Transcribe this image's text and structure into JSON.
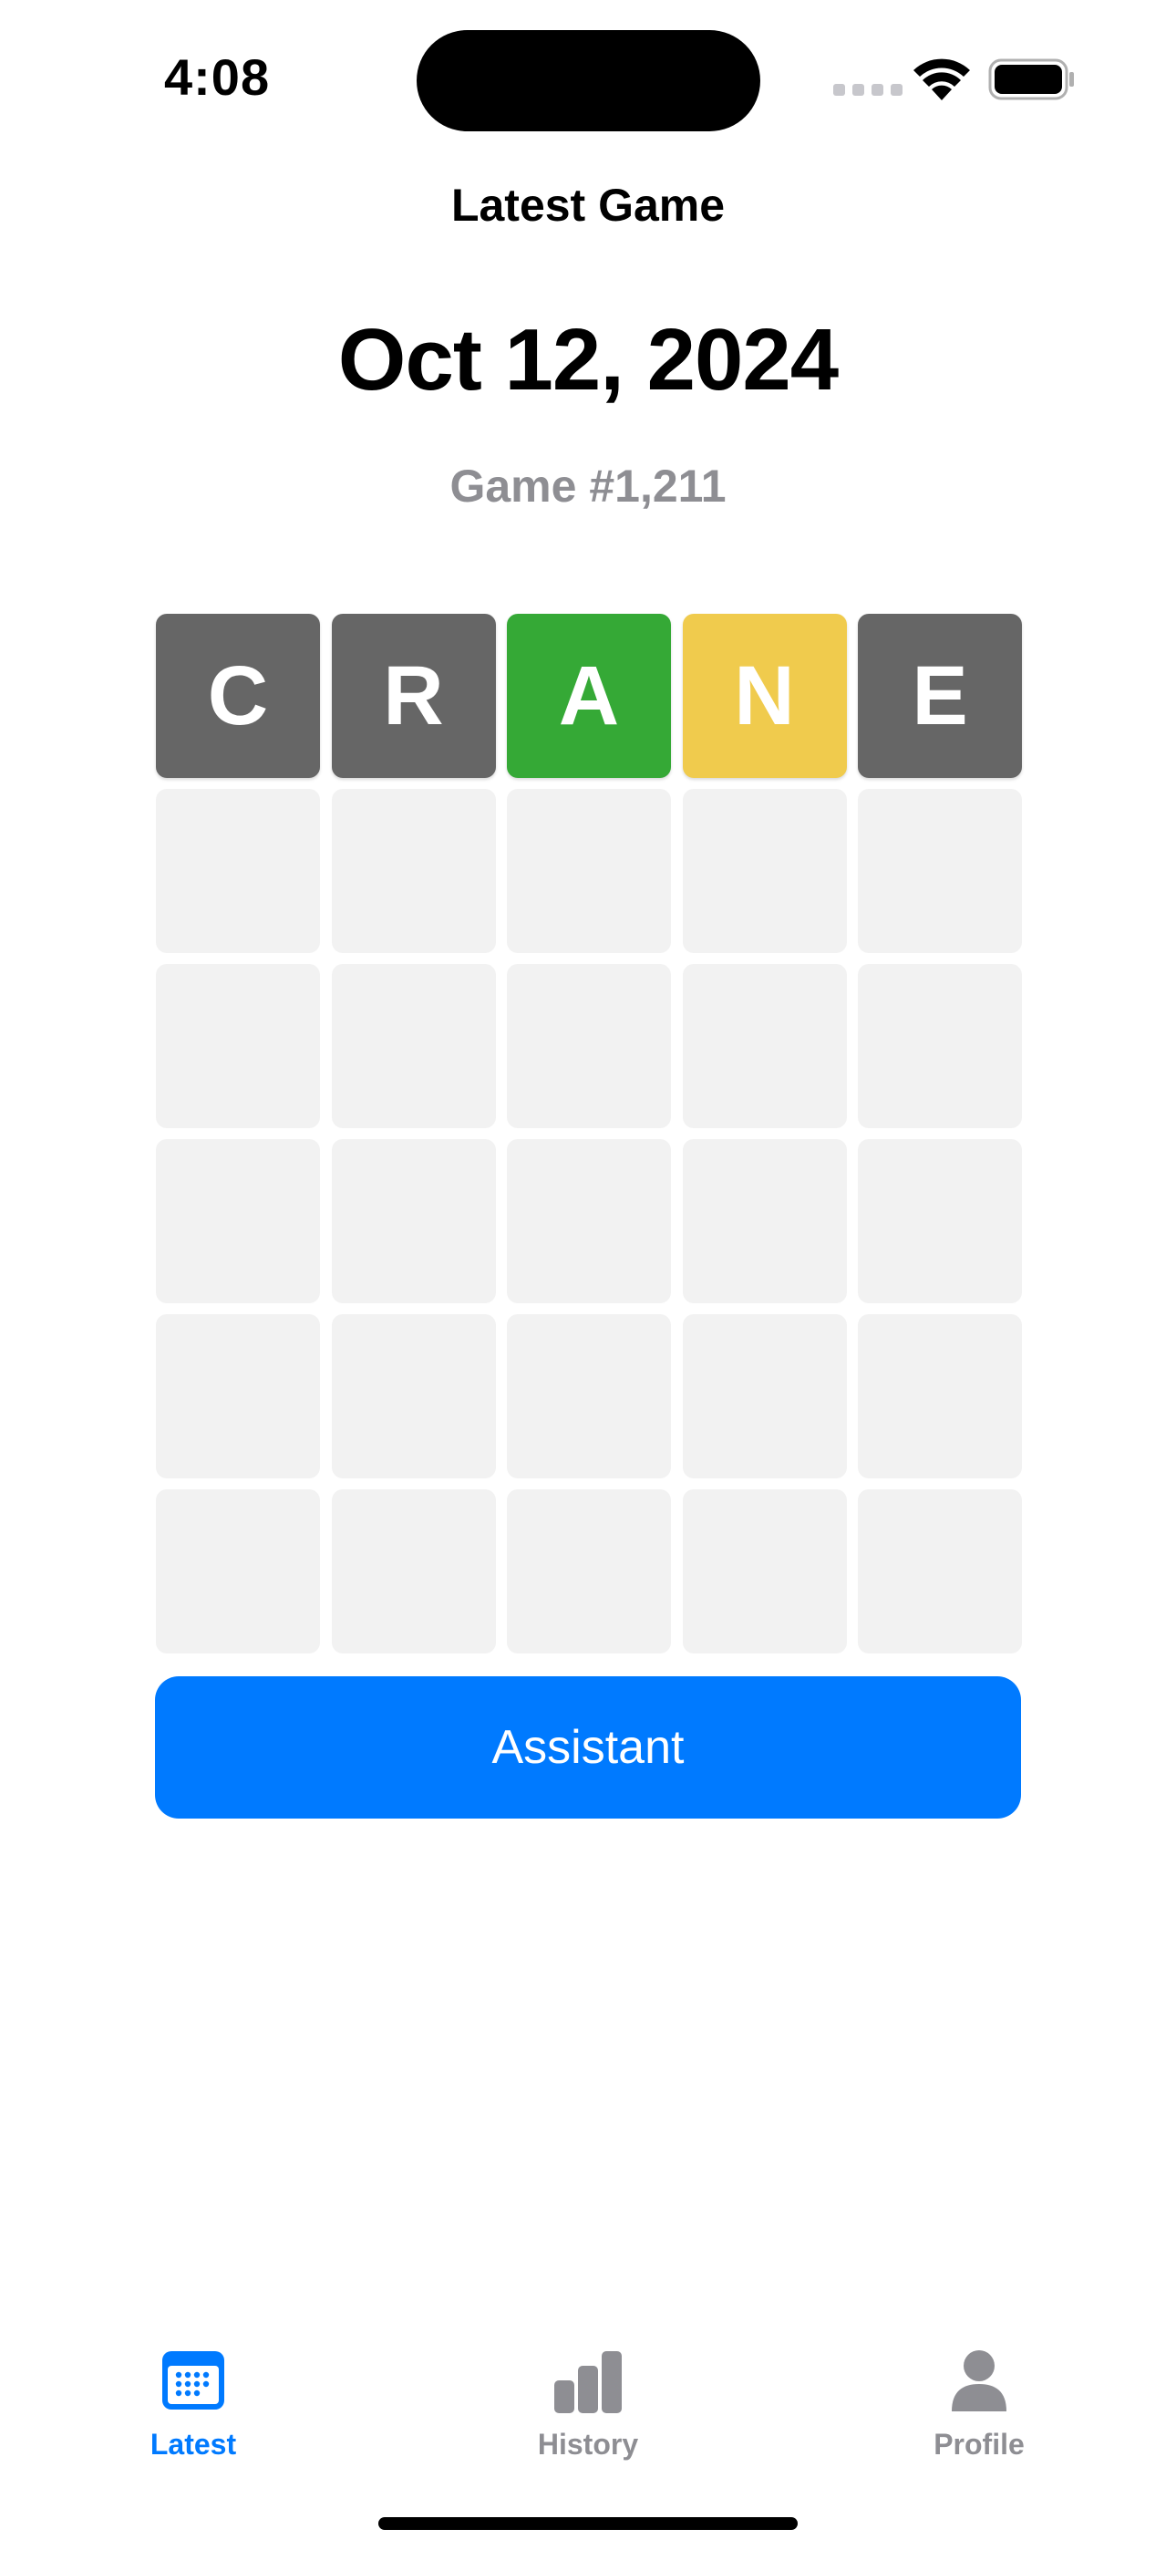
{
  "status_bar": {
    "time": "4:08"
  },
  "header": {
    "title": "Latest Game",
    "date": "Oct 12, 2024",
    "game_number": "Game #1,211"
  },
  "board": {
    "colors": {
      "absent": "#666666",
      "correct": "#35a936",
      "present": "#f0cb4d",
      "empty": "#f2f2f2"
    },
    "rows": [
      [
        {
          "letter": "C",
          "state": "absent"
        },
        {
          "letter": "R",
          "state": "absent"
        },
        {
          "letter": "A",
          "state": "correct"
        },
        {
          "letter": "N",
          "state": "present"
        },
        {
          "letter": "E",
          "state": "absent"
        }
      ],
      [
        {
          "letter": "",
          "state": "empty"
        },
        {
          "letter": "",
          "state": "empty"
        },
        {
          "letter": "",
          "state": "empty"
        },
        {
          "letter": "",
          "state": "empty"
        },
        {
          "letter": "",
          "state": "empty"
        }
      ],
      [
        {
          "letter": "",
          "state": "empty"
        },
        {
          "letter": "",
          "state": "empty"
        },
        {
          "letter": "",
          "state": "empty"
        },
        {
          "letter": "",
          "state": "empty"
        },
        {
          "letter": "",
          "state": "empty"
        }
      ],
      [
        {
          "letter": "",
          "state": "empty"
        },
        {
          "letter": "",
          "state": "empty"
        },
        {
          "letter": "",
          "state": "empty"
        },
        {
          "letter": "",
          "state": "empty"
        },
        {
          "letter": "",
          "state": "empty"
        }
      ],
      [
        {
          "letter": "",
          "state": "empty"
        },
        {
          "letter": "",
          "state": "empty"
        },
        {
          "letter": "",
          "state": "empty"
        },
        {
          "letter": "",
          "state": "empty"
        },
        {
          "letter": "",
          "state": "empty"
        }
      ],
      [
        {
          "letter": "",
          "state": "empty"
        },
        {
          "letter": "",
          "state": "empty"
        },
        {
          "letter": "",
          "state": "empty"
        },
        {
          "letter": "",
          "state": "empty"
        },
        {
          "letter": "",
          "state": "empty"
        }
      ]
    ]
  },
  "actions": {
    "assistant_label": "Assistant"
  },
  "tab_bar": {
    "active_color": "#007aff",
    "inactive_color": "#8e8e93",
    "tabs": [
      {
        "label": "Latest",
        "icon": "calendar-icon",
        "active": true
      },
      {
        "label": "History",
        "icon": "bar-chart-icon",
        "active": false
      },
      {
        "label": "Profile",
        "icon": "person-icon",
        "active": false
      }
    ]
  }
}
